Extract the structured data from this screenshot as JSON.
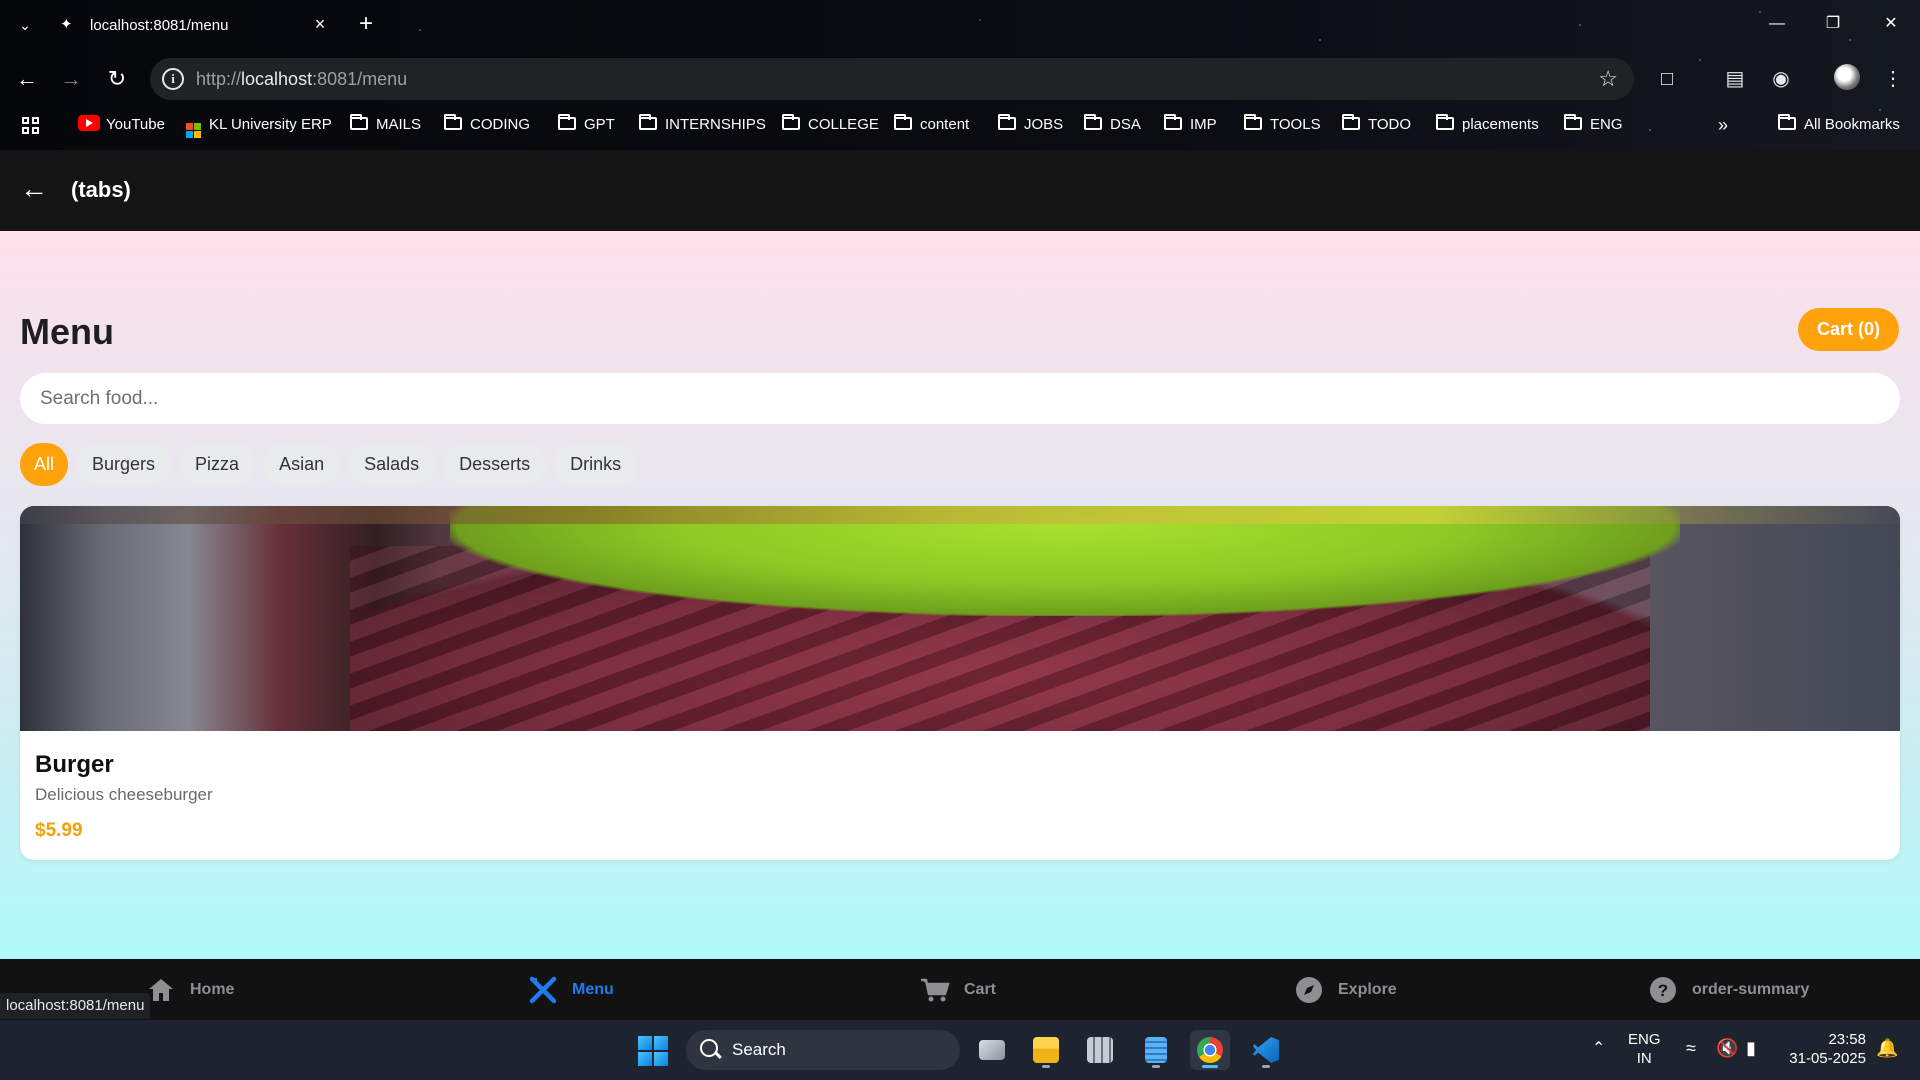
{
  "browser": {
    "tab_title": "localhost:8081/menu",
    "url_prefix": "http://",
    "url_host": "localhost",
    "url_rest": ":8081/menu",
    "status_url": "localhost:8081/menu",
    "bookmarks": [
      "YouTube",
      "KL University ERP",
      "MAILS",
      "CODING",
      "GPT",
      "INTERNSHIPS",
      "COLLEGE",
      "content",
      "JOBS",
      "DSA",
      "IMP",
      "TOOLS",
      "TODO",
      "placements",
      "ENG"
    ],
    "all_bookmarks": "All Bookmarks"
  },
  "header": {
    "title": "(tabs)"
  },
  "page": {
    "title": "Menu",
    "cart_label": "Cart (0)",
    "search_placeholder": "Search food...",
    "categories": [
      "All",
      "Burgers",
      "Pizza",
      "Asian",
      "Salads",
      "Desserts",
      "Drinks"
    ],
    "active_category": "All"
  },
  "items": [
    {
      "name": "Burger",
      "description": "Delicious cheeseburger",
      "price": "$5.99"
    }
  ],
  "bottom_nav": [
    {
      "label": "Home",
      "icon": "home-icon"
    },
    {
      "label": "Menu",
      "icon": "utensils-icon",
      "active": true
    },
    {
      "label": "Cart",
      "icon": "cart-icon"
    },
    {
      "label": "Explore",
      "icon": "compass-icon"
    },
    {
      "label": "order-summary",
      "icon": "help-icon"
    }
  ],
  "taskbar": {
    "search_label": "Search",
    "lang_top": "ENG",
    "lang_bottom": "IN",
    "time": "23:58",
    "date": "31-05-2025"
  },
  "colors": {
    "accent": "#ffa20b",
    "nav_active": "#1e7bf0",
    "header_bg": "#141414"
  }
}
